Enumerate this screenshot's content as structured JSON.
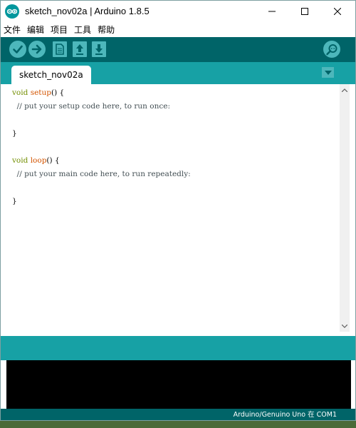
{
  "window": {
    "title": "sketch_nov02a | Arduino 1.8.5"
  },
  "menubar": {
    "items": [
      "文件",
      "编辑",
      "项目",
      "工具",
      "帮助"
    ]
  },
  "toolbar": {
    "verify": "verify-icon",
    "upload": "upload-arrow-icon",
    "new": "new-file-icon",
    "open": "open-arrow-up-icon",
    "save": "save-arrow-down-icon",
    "serial_monitor": "serial-monitor-icon"
  },
  "tabs": {
    "active": "sketch_nov02a"
  },
  "editor": {
    "lines": [
      {
        "kw": "void",
        "fn": "setup",
        "rest": "() {"
      },
      {
        "comment": "  // put your setup code here, to run once:"
      },
      {
        "blank": ""
      },
      {
        "plain": "}"
      },
      {
        "blank": ""
      },
      {
        "kw": "void",
        "fn": "loop",
        "rest": "() {"
      },
      {
        "comment": "  // put your main code here, to run repeatedly:"
      },
      {
        "blank": ""
      },
      {
        "plain": "}"
      }
    ]
  },
  "status_footer": {
    "board": "Arduino/Genuino Uno 在 COM1"
  },
  "colors": {
    "toolbar": "#006468",
    "tabbar": "#17a1a5",
    "button": "#4db7bb",
    "keyword": "#728e00",
    "function": "#d35400"
  }
}
